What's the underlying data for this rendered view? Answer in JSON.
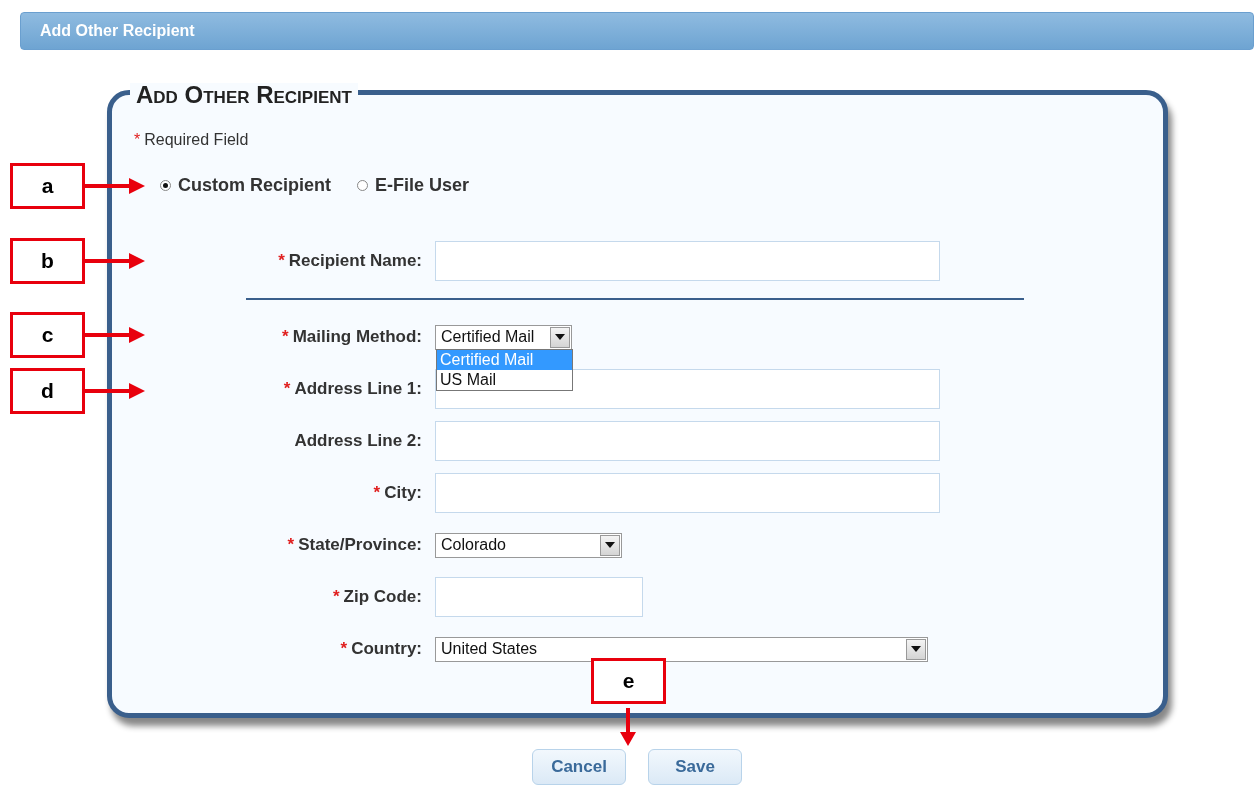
{
  "header": {
    "title": "Add Other Recipient"
  },
  "form": {
    "legend": "Add Other Recipient",
    "required_note": {
      "marker": "*",
      "text": "Required Field"
    },
    "recipient_types": [
      {
        "label": "Custom Recipient",
        "selected": true
      },
      {
        "label": "E-File User",
        "selected": false
      }
    ],
    "name_fields": [
      {
        "kind": "text",
        "label": "Recipient Name:",
        "marker": "*"
      }
    ],
    "address_fields": [
      {
        "kind": "select",
        "label": "Mailing Method:",
        "marker": "*",
        "value": "Certified Mail",
        "expanded": true,
        "options": [
          {
            "label": "Certified Mail",
            "selected": true
          },
          {
            "label": "US Mail",
            "selected": false
          }
        ]
      },
      {
        "kind": "text",
        "label": "Address Line 1:",
        "marker": "*"
      },
      {
        "kind": "text",
        "label": "Address Line 2:"
      },
      {
        "kind": "text",
        "label": "City:",
        "marker": "*"
      },
      {
        "kind": "select",
        "label": "State/Province:",
        "marker": "*",
        "value": "Colorado"
      },
      {
        "kind": "text",
        "label": "Zip Code:",
        "marker": "*"
      },
      {
        "kind": "select",
        "label": "Country:",
        "marker": "*",
        "value": "United States"
      }
    ]
  },
  "buttons": [
    {
      "label": "Cancel"
    },
    {
      "label": "Save"
    }
  ],
  "callouts": [
    {
      "label": "a",
      "kind": "right"
    },
    {
      "label": "b",
      "kind": "right"
    },
    {
      "label": "c",
      "kind": "right"
    },
    {
      "label": "d",
      "kind": "right"
    },
    {
      "label": "e",
      "kind": "down"
    }
  ]
}
